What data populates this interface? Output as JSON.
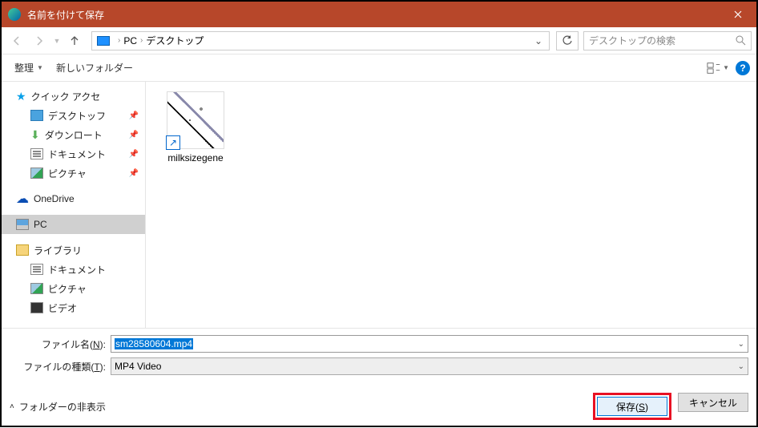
{
  "titlebar": {
    "title": "名前を付けて保存"
  },
  "breadcrumb": {
    "pc": "PC",
    "location": "デスクトップ"
  },
  "search": {
    "placeholder": "デスクトップの検索"
  },
  "toolbar": {
    "organize": "整理",
    "newfolder": "新しいフォルダー"
  },
  "sidebar": {
    "quick": "クイック アクセ",
    "desktop": "デスクトッフ",
    "downloads": "ダウンロート",
    "documents": "ドキュメント",
    "pictures": "ピクチャ",
    "onedrive": "OneDrive",
    "pc": "PC",
    "library": "ライブラリ",
    "lib_docs": "ドキュメント",
    "lib_pics": "ピクチャ",
    "lib_video": "ビデオ"
  },
  "file": {
    "name": "milksizegene"
  },
  "fields": {
    "filename_label_pre": "ファイル名(",
    "filename_label_u": "N",
    "filename_label_post": "):",
    "filename_value": "sm28580604.mp4",
    "filetype_label_pre": "ファイルの種類(",
    "filetype_label_u": "T",
    "filetype_label_post": "):",
    "filetype_value": "MP4 Video"
  },
  "footer": {
    "folders": "フォルダーの非表示",
    "save": "保存(S)",
    "cancel": "キャンセル"
  }
}
